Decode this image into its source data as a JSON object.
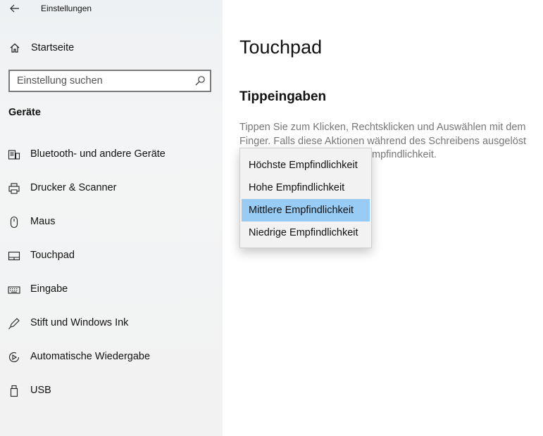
{
  "window": {
    "title": "Einstellungen"
  },
  "sidebar": {
    "home_label": "Startseite",
    "search_placeholder": "Einstellung suchen",
    "section": "Geräte",
    "items": [
      {
        "label": "Bluetooth- und andere Geräte",
        "icon": "bluetooth-devices-icon"
      },
      {
        "label": "Drucker & Scanner",
        "icon": "printer-icon"
      },
      {
        "label": "Maus",
        "icon": "mouse-icon"
      },
      {
        "label": "Touchpad",
        "icon": "touchpad-icon"
      },
      {
        "label": "Eingabe",
        "icon": "keyboard-icon"
      },
      {
        "label": "Stift und Windows Ink",
        "icon": "pen-icon"
      },
      {
        "label": "Automatische Wiedergabe",
        "icon": "autoplay-icon"
      },
      {
        "label": "USB",
        "icon": "usb-icon"
      }
    ]
  },
  "main": {
    "title": "Touchpad",
    "section_title": "Tippeingaben",
    "description_line1": "Tippen Sie zum Klicken, Rechtsklicken und Auswählen mit dem",
    "description_line2": "Finger. Falls diese Aktionen während des Schreibens ausgelöst",
    "description_line3": "mpfindlichkeit."
  },
  "dropdown": {
    "options": [
      {
        "label": "Höchste Empfindlichkeit"
      },
      {
        "label": "Hohe Empfindlichkeit"
      },
      {
        "label": "Mittlere Empfindlichkeit"
      },
      {
        "label": "Niedrige Empfindlichkeit"
      }
    ],
    "selected_label": "Mittlere Empfindlichkeit"
  },
  "colors": {
    "selection": "#99ccf4",
    "sidebar_bg": "#f2f2f2",
    "description_text": "#777777"
  }
}
